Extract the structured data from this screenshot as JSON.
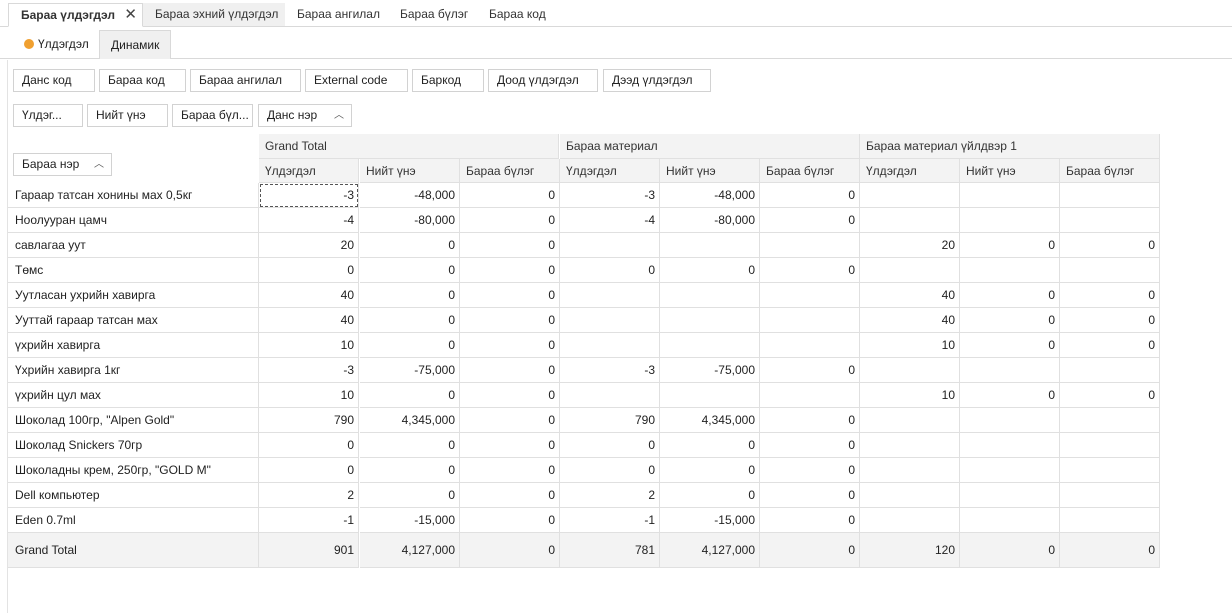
{
  "tabs": [
    {
      "label": "Бараа үлдэгдэл",
      "active": true
    },
    {
      "label": "Бараа эхний үлдэгдэл"
    },
    {
      "label": "Бараа ангилал"
    },
    {
      "label": "Бараа бүлэг"
    },
    {
      "label": "Бараа код"
    }
  ],
  "subtabs": {
    "remaining": "Үлдэгдэл",
    "dynamic": "Динамик"
  },
  "filter_fields": [
    "Данс код",
    "Бараа код",
    "Бараа ангилал",
    "External code",
    "Баркод",
    "Доод үлдэгдэл",
    "Дээд үлдэгдэл"
  ],
  "data_fields": [
    "Үлдэг...",
    "Нийт үнэ",
    "Бараа бүл..."
  ],
  "column_field": "Данс нэр",
  "row_field": "Бараа нэр",
  "column_groups": [
    "Grand Total",
    "Бараа материал",
    "Бараа материал үйлдвэр 1"
  ],
  "measures": [
    "Үлдэгдэл",
    "Нийт үнэ",
    "Бараа бүлэг"
  ],
  "rows": [
    {
      "name": "Гараар татсан хонины мах 0,5кг",
      "cells": [
        "-3",
        "-48,000",
        "0",
        "-3",
        "-48,000",
        "0",
        "",
        "",
        ""
      ]
    },
    {
      "name": "Ноолууран цамч",
      "cells": [
        "-4",
        "-80,000",
        "0",
        "-4",
        "-80,000",
        "0",
        "",
        "",
        ""
      ]
    },
    {
      "name": "савлагаа уут",
      "cells": [
        "20",
        "0",
        "0",
        "",
        "",
        "",
        "20",
        "0",
        "0"
      ]
    },
    {
      "name": "Төмс",
      "cells": [
        "0",
        "0",
        "0",
        "0",
        "0",
        "0",
        "",
        "",
        ""
      ]
    },
    {
      "name": "Уутласан ухрийн хавирга",
      "cells": [
        "40",
        "0",
        "0",
        "",
        "",
        "",
        "40",
        "0",
        "0"
      ]
    },
    {
      "name": "Ууттай гараар татсан мах",
      "cells": [
        "40",
        "0",
        "0",
        "",
        "",
        "",
        "40",
        "0",
        "0"
      ]
    },
    {
      "name": "үхрийн хавирга",
      "cells": [
        "10",
        "0",
        "0",
        "",
        "",
        "",
        "10",
        "0",
        "0"
      ]
    },
    {
      "name": "Үхрийн хавирга 1кг",
      "cells": [
        "-3",
        "-75,000",
        "0",
        "-3",
        "-75,000",
        "0",
        "",
        "",
        ""
      ]
    },
    {
      "name": "үхрийн цул мах",
      "cells": [
        "10",
        "0",
        "0",
        "",
        "",
        "",
        "10",
        "0",
        "0"
      ]
    },
    {
      "name": "Шоколад 100гр, \"Alpen Gold\"",
      "cells": [
        "790",
        "4,345,000",
        "0",
        "790",
        "4,345,000",
        "0",
        "",
        "",
        ""
      ]
    },
    {
      "name": "Шоколад Snickers 70гр",
      "cells": [
        "0",
        "0",
        "0",
        "0",
        "0",
        "0",
        "",
        "",
        ""
      ]
    },
    {
      "name": "Шоколадны крем, 250гр, \"GOLD M\"",
      "cells": [
        "0",
        "0",
        "0",
        "0",
        "0",
        "0",
        "",
        "",
        ""
      ]
    },
    {
      "name": "Dell компьютер",
      "cells": [
        "2",
        "0",
        "0",
        "2",
        "0",
        "0",
        "",
        "",
        ""
      ]
    },
    {
      "name": "Eden 0.7ml",
      "cells": [
        "-1",
        "-15,000",
        "0",
        "-1",
        "-15,000",
        "0",
        "",
        "",
        ""
      ]
    }
  ],
  "grand_total": {
    "label": "Grand Total",
    "cells": [
      "901",
      "4,127,000",
      "0",
      "781",
      "4,127,000",
      "0",
      "120",
      "0",
      "0"
    ]
  }
}
